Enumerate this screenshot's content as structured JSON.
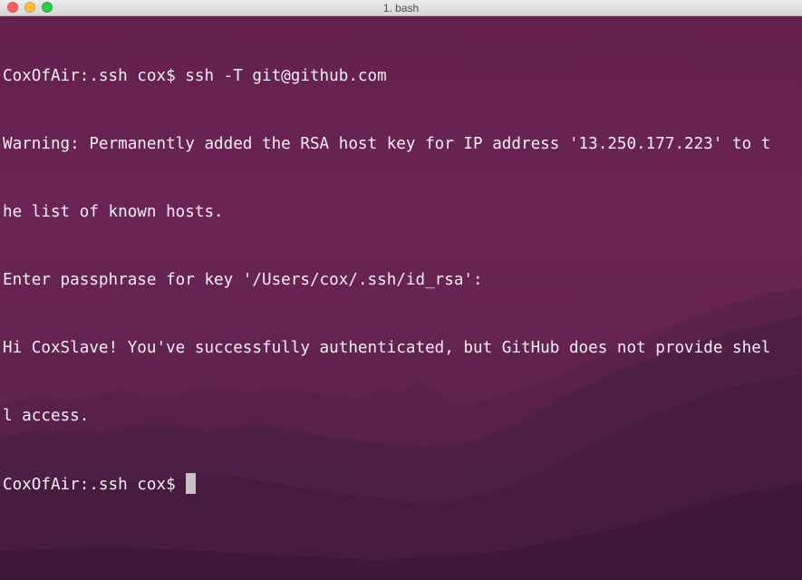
{
  "window": {
    "title": "1. bash",
    "controls": [
      "close",
      "minimize",
      "zoom"
    ]
  },
  "terminal": {
    "lines": [
      "CoxOfAir:.ssh cox$ ssh -T git@github.com",
      "Warning: Permanently added the RSA host key for IP address '13.250.177.223' to t",
      "he list of known hosts.",
      "Enter passphrase for key '/Users/cox/.ssh/id_rsa':",
      "Hi CoxSlave! You've successfully authenticated, but GitHub does not provide shel",
      "l access."
    ],
    "prompt": "CoxOfAir:.ssh cox$ ",
    "cursor": "block"
  },
  "colors": {
    "background": "#63214f",
    "text": "#f6eef4",
    "cursor": "#c9c0c6"
  }
}
